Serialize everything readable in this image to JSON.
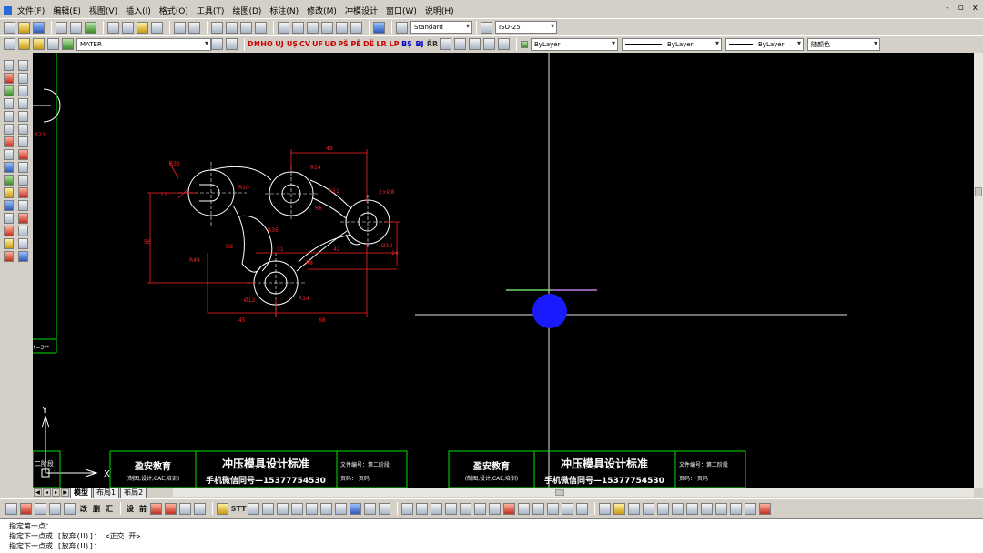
{
  "menus": [
    "文件(F)",
    "编辑(E)",
    "视图(V)",
    "插入(I)",
    "格式(O)",
    "工具(T)",
    "绘图(D)",
    "标注(N)",
    "修改(M)",
    "冲模设计",
    "窗口(W)",
    "说明(H)"
  ],
  "window_controls": [
    "-",
    "▫",
    "x"
  ],
  "toolbar": {
    "text_style": "Standard",
    "dim_style": "ISO-25",
    "layer": "MATER",
    "color": "ByLayer",
    "linetype": "ByLayer",
    "lineweight": "ByLayer",
    "plotstyle": "随颜色",
    "red_cmds": [
      "ĐĦ",
      "HO",
      "UJ",
      "UȘ",
      "CV",
      "UF",
      "UĐ",
      "PŠ",
      "PË",
      "DË",
      "LR",
      "LP",
      "BŞ",
      "BJ",
      "ŘR"
    ]
  },
  "toolbar_bottom_text": [
    "改",
    "删",
    "汇",
    "设",
    "前",
    "STT"
  ],
  "drawing": {
    "dims": [
      "49",
      "R14",
      "R10",
      "R11",
      "R6",
      "R36",
      "R49",
      "R8",
      "R8",
      "31",
      "42",
      "24",
      "45",
      "68",
      "17",
      "56",
      "Ø12",
      "Ø12",
      "R33",
      "R14",
      "2×Ø8",
      "Ø16",
      "2×Ø2"
    ],
    "left_label": "R23",
    "left_label2": "t=3**"
  },
  "title_block": {
    "company": "盈安教育",
    "company_sub": "(制图,设计,CAE,培训)",
    "title": "冲压模具设计标准",
    "contact": "手机微信同号—15377754530",
    "file_no": "文件编号：第二阶段",
    "page": "页码：  页码",
    "partial": "二阶段"
  },
  "axis": {
    "y": "Y",
    "x": "X"
  },
  "layout_tabs": [
    "模型",
    "布局1",
    "布局2"
  ],
  "command_line": [
    "指定第一点：",
    "指定下一点或 [放弃(U)]：  <正交 开>",
    "指定下一点或 [放弃(U)]："
  ],
  "colors": {
    "canvas": "#000000",
    "geometry": "#ffffff",
    "dimension": "#ff2020",
    "border": "#00e000",
    "crosshair": "#e0e0e0",
    "blob": "#1a1aff"
  }
}
